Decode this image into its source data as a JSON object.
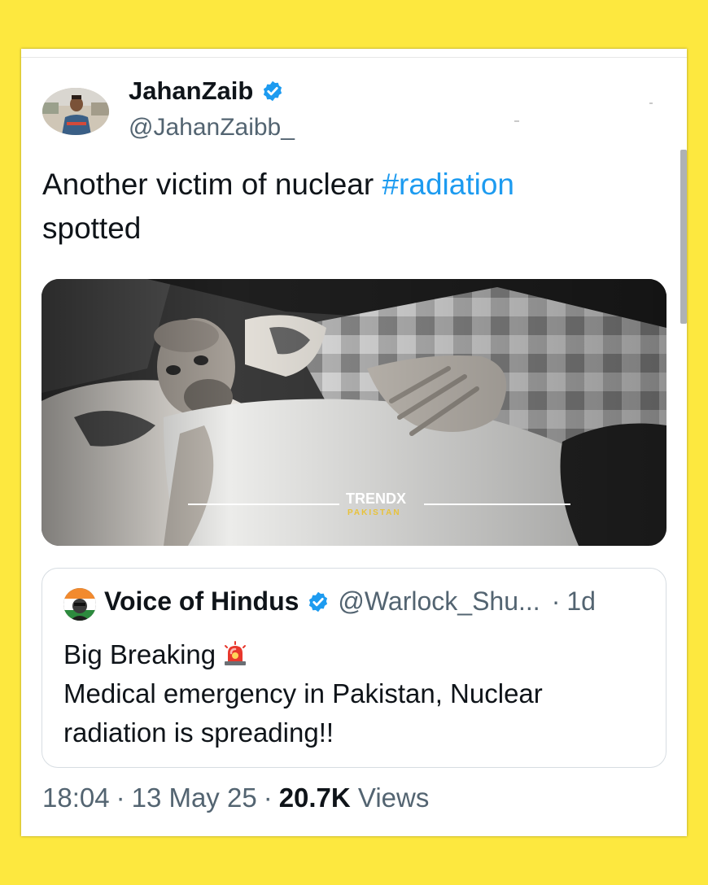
{
  "tweet": {
    "author_name": "JahanZaib",
    "author_handle": "@JahanZaibb_",
    "text_before": "Another victim of nuclear ",
    "hashtag": "#radiation",
    "text_after": "spotted",
    "media": {
      "watermark_top": "TRENDX",
      "watermark_bottom": "PAKISTAN"
    },
    "time": "18:04",
    "date": "13 May 25",
    "separator": "·",
    "views_count": "20.7K",
    "views_label": "Views"
  },
  "quote": {
    "author_name": "Voice of Hindus",
    "author_handle": "@Warlock_Shu...",
    "separator": "·",
    "time": "1d",
    "line1": "Big Breaking",
    "line2": "Medical emergency in Pakistan, Nuclear radiation is spreading!!",
    "emoji": "rotating-light-icon"
  },
  "colors": {
    "background": "#fde83f",
    "link": "#1d9bf0",
    "verified": "#1d9bf0",
    "muted": "#536471",
    "text": "#0f1419"
  }
}
